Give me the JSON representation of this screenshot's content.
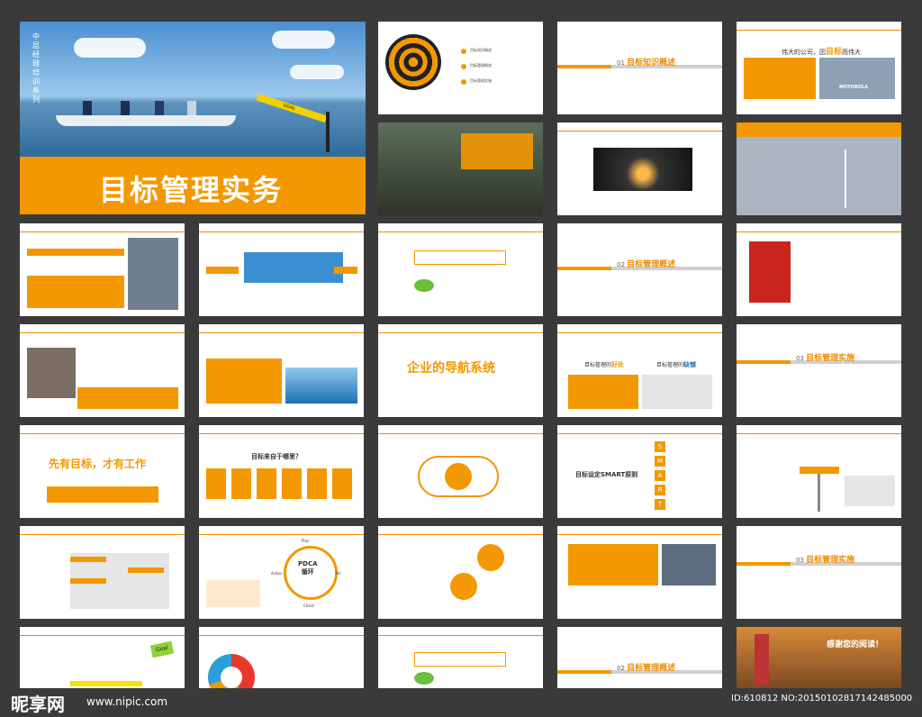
{
  "cover": {
    "series": "中层经理培训系列",
    "title": "目标管理实务",
    "goal_tag": "GOAL"
  },
  "slides": {
    "agenda": {
      "items": [
        "目标知识概述",
        "目标管理概述",
        "目标管理实施"
      ]
    },
    "sec1": {
      "num": "01",
      "title": "目标知识概述"
    },
    "sec2": {
      "num": "02",
      "title": "目标管理概述"
    },
    "sec3": {
      "num": "03",
      "title": "目标管理实施"
    },
    "sec3b": {
      "num": "03",
      "title": "目标管理实施"
    },
    "sec2b": {
      "num": "02",
      "title": "目标管理概述"
    },
    "motorola": {
      "headline": "伟大的公司，因",
      "highlight": "目标",
      "tail": "而伟大",
      "brand": "MOTOROLA"
    },
    "nav": {
      "pre": "企业的导航系统"
    },
    "goodbad": {
      "good_pre": "目标管理的",
      "good": "好处",
      "bad_pre": "目标管理的",
      "bad": "缺憾"
    },
    "first": {
      "title": "先有目标，才有工作"
    },
    "where": {
      "title": "目标来自于哪里？"
    },
    "smart": {
      "title": "目标设定SMART原则",
      "letters": [
        "S",
        "M",
        "A",
        "R",
        "T"
      ]
    },
    "pdca": {
      "title": "PDCA",
      "sub": "循环",
      "plan": "Plan",
      "do": "Do",
      "check": "Check",
      "action": "Action"
    },
    "thanks": {
      "title": "感谢您的阅读！"
    },
    "goal_note": {
      "label": "Goal"
    }
  },
  "watermark": {
    "brand": "昵享网",
    "url": "www.nipic.com",
    "id": "ID:610812 NO:20150102817142485000"
  },
  "colors": {
    "accent": "#f39800",
    "background": "#3a3a3a",
    "blue": "#2b7fc6"
  }
}
